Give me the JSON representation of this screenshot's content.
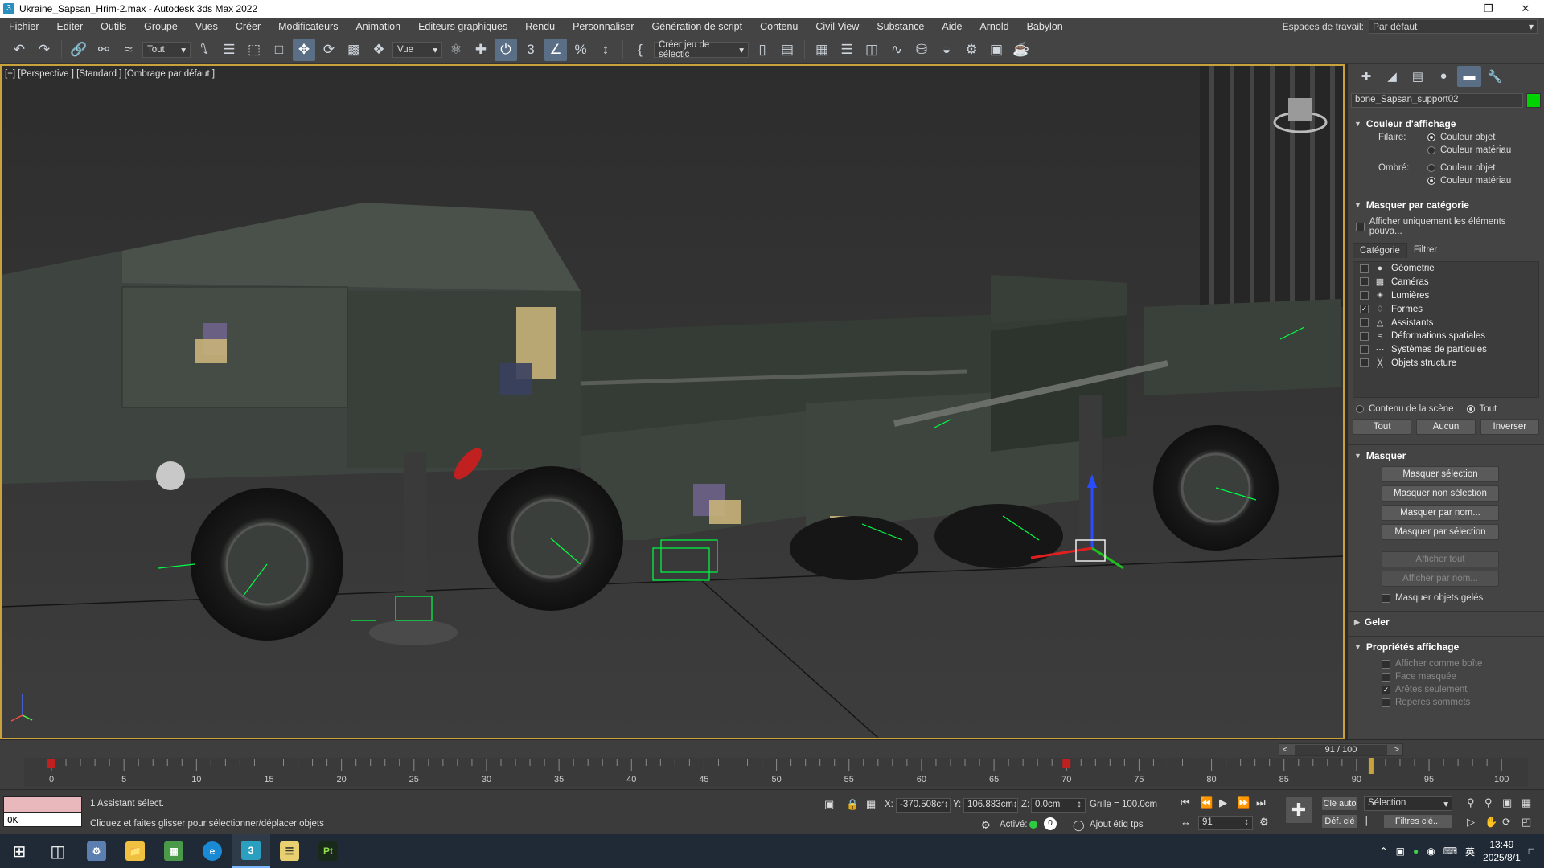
{
  "window": {
    "title": "Ukraine_Sapsan_Hrim-2.max - Autodesk 3ds Max 2022",
    "icon": "3ds-max-icon"
  },
  "menu": {
    "items": [
      "Fichier",
      "Editer",
      "Outils",
      "Groupe",
      "Vues",
      "Créer",
      "Modificateurs",
      "Animation",
      "Editeurs graphiques",
      "Rendu",
      "Personnaliser",
      "Génération de script",
      "Contenu",
      "Civil View",
      "Substance",
      "Aide",
      "Arnold",
      "Babylon"
    ],
    "workspace_label": "Espaces de travail:",
    "workspace_value": "Par défaut"
  },
  "toolbar": {
    "filter_value": "Tout",
    "coord_system": "Vue",
    "selection_set": "Créer jeu de sélectic"
  },
  "viewport": {
    "label": "[+] [Perspective ] [Standard ] [Ombrage par défaut ]",
    "accent": "#c9a23c"
  },
  "command_panel": {
    "object_name": "bone_Sapsan_support02",
    "object_color": "#00d400",
    "display_color": {
      "title": "Couleur d'affichage",
      "wire_label": "Filaire:",
      "shaded_label": "Ombré:",
      "opt_object": "Couleur objet",
      "opt_material": "Couleur matériau"
    },
    "hide_by_category": {
      "title": "Masquer par catégorie",
      "show_only": "Afficher uniquement les éléments pouva...",
      "tab_category": "Catégorie",
      "tab_filter": "Filtrer",
      "items": [
        {
          "label": "Géométrie",
          "checked": false
        },
        {
          "label": "Caméras",
          "checked": false
        },
        {
          "label": "Lumières",
          "checked": false
        },
        {
          "label": "Formes",
          "checked": true
        },
        {
          "label": "Assistants",
          "checked": false
        },
        {
          "label": "Déformations spatiales",
          "checked": false
        },
        {
          "label": "Systèmes de particules",
          "checked": false
        },
        {
          "label": "Objets structure",
          "checked": false
        }
      ],
      "scene_content": "Contenu de la scène",
      "all_radio": "Tout",
      "btn_all": "Tout",
      "btn_none": "Aucun",
      "btn_invert": "Inverser"
    },
    "hide": {
      "title": "Masquer",
      "b1": "Masquer sélection",
      "b2": "Masquer non sélection",
      "b3": "Masquer par nom...",
      "b4": "Masquer par sélection",
      "b5": "Afficher tout",
      "b6": "Afficher par nom...",
      "frozen": "Masquer objets gelés"
    },
    "freeze": {
      "title": "Geler"
    },
    "display_props": {
      "title": "Propriétés affichage",
      "p1": "Afficher comme boîte",
      "p2": "Face masquée",
      "p3": "Arêtes seulement",
      "p4": "Repères sommets"
    }
  },
  "timeline": {
    "frame_display": "91 / 100",
    "current_frame": 91,
    "total_frames": 100,
    "key_frames": [
      0,
      70
    ],
    "ticks": [
      "0",
      "5",
      "10",
      "15",
      "20",
      "25",
      "30",
      "35",
      "40",
      "45",
      "50",
      "55",
      "60",
      "65",
      "70",
      "75",
      "80",
      "85",
      "90",
      "95",
      "100"
    ]
  },
  "status": {
    "maxscript_out": "OK",
    "selection": "1 Assistant sélect.",
    "prompt": "Cliquez et faites glisser pour sélectionner/déplacer objets",
    "x_label": "X:",
    "x": "-370.508cr",
    "y_label": "Y:",
    "y": "106.883cm",
    "z_label": "Z:",
    "z": "0.0cm",
    "grid": "Grille = 100.0cm",
    "active_label": "Activé:",
    "active_value": "0",
    "add_tag": "Ajout étiq tps",
    "frame_field": "91",
    "auto_key": "Clé auto",
    "set_key": "Déf. clé",
    "key_mode": "Sélection",
    "key_filters": "Filtres clé..."
  },
  "taskbar": {
    "time": "13:49",
    "date": "2025/8/1",
    "ime": "英"
  }
}
